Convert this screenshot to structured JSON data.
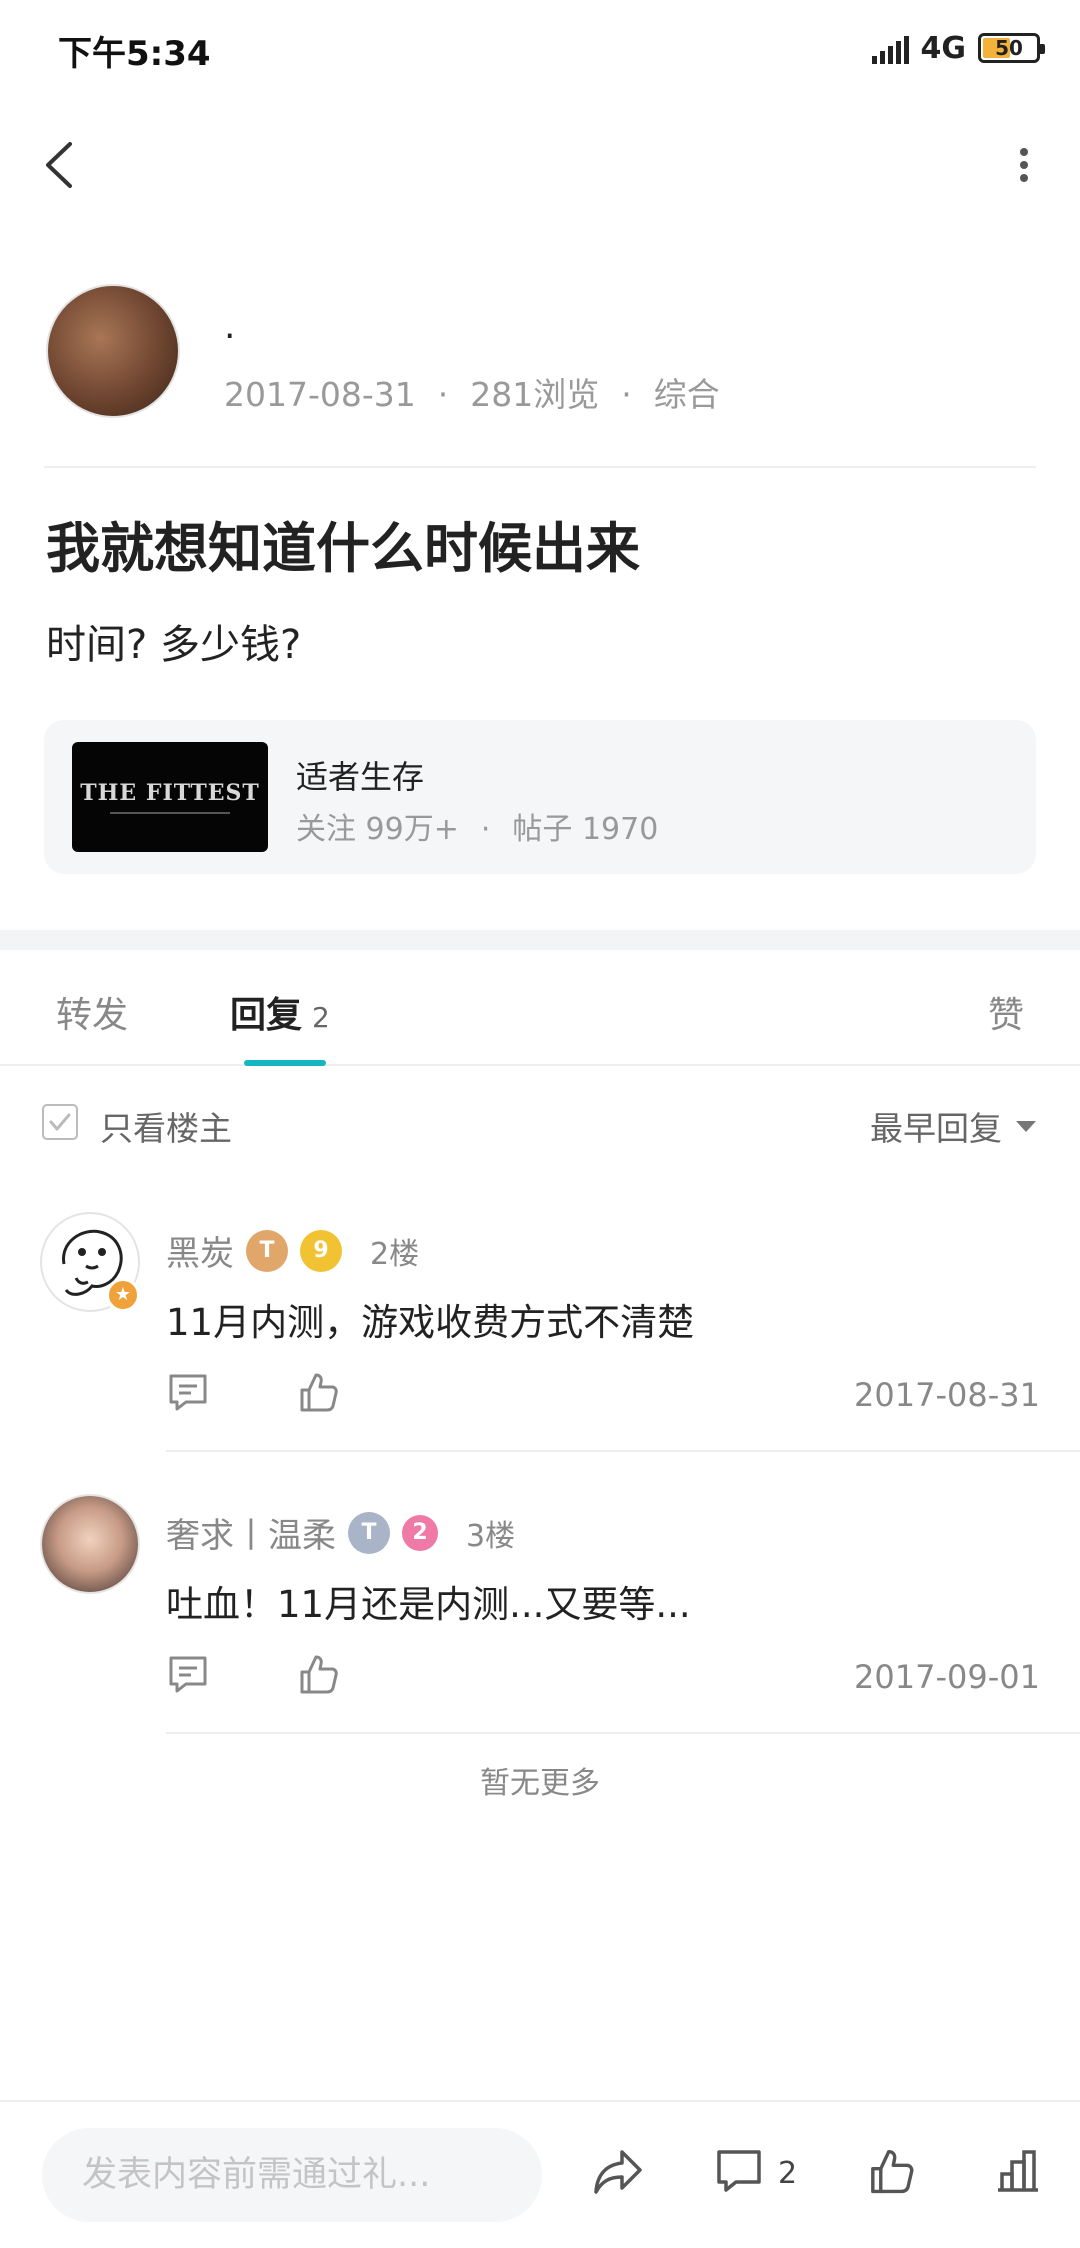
{
  "status_bar": {
    "time": "下午5:34",
    "network": "4G",
    "battery": "50"
  },
  "post": {
    "author_name": ".",
    "date": "2017-08-31",
    "views": "281浏览",
    "category": "综合",
    "title": "我就想知道什么时候出来",
    "body": "时间? 多少钱?"
  },
  "game": {
    "logo_text": "THE FITTEST",
    "name": "适者生存",
    "followers": "关注 99万+",
    "posts": "帖子 1970"
  },
  "tabs": {
    "forward": "转发",
    "reply": "回复",
    "reply_count": "2",
    "like": "赞"
  },
  "filter": {
    "only_op": "只看楼主",
    "sort": "最早回复"
  },
  "replies": [
    {
      "name": "黑炭",
      "level1": "T",
      "level2": "9",
      "floor": "2楼",
      "text": "11月内测，游戏收费方式不清楚",
      "date": "2017-08-31"
    },
    {
      "name": "奢求丨温柔",
      "level1": "T",
      "level2": "2",
      "floor": "3楼",
      "text": "吐血！11月还是内测...又要等...",
      "date": "2017-09-01"
    }
  ],
  "no_more": "暂无更多",
  "bottom_bar": {
    "compose_placeholder": "发表内容前需通过礼...",
    "comment_count": "2"
  },
  "colors": {
    "accent": "#15b5c2",
    "text_muted": "#888888",
    "level_bronze": "#e0a66a",
    "level_gold": "#f1c232",
    "level_silver": "#a9b4c8",
    "level_pink": "#f07aa6"
  }
}
